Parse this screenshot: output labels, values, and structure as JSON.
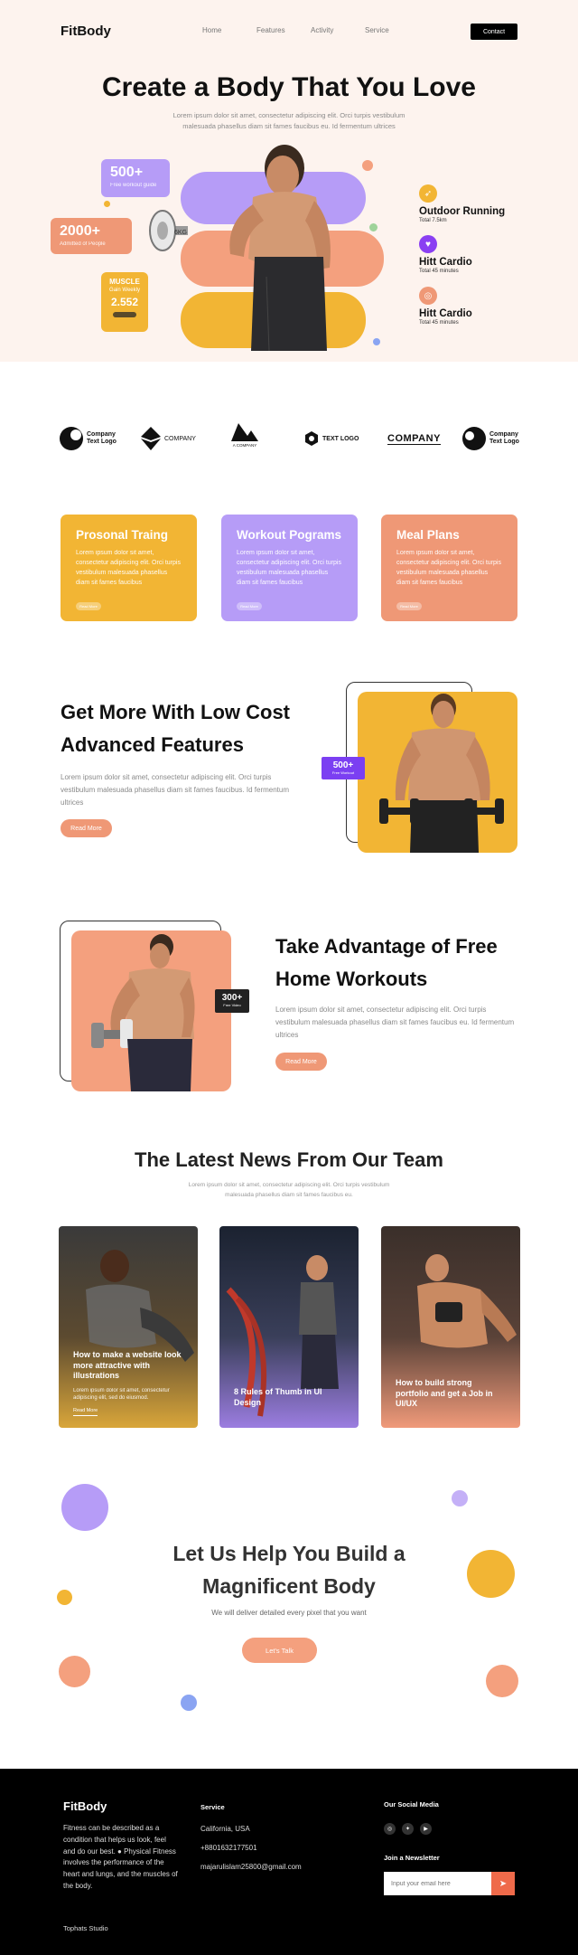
{
  "nav": {
    "logo": "FitBody",
    "links": [
      "Home",
      "Features",
      "Activity",
      "Service"
    ],
    "contact": "Contact"
  },
  "hero": {
    "title": "Create a Body That You Love",
    "subtitle": "Lorem ipsum dolor sit amet, consectetur adipiscing elit. Orci turpis vestibulum malesuada phasellus diam sit fames faucibus eu. Id fermentum ultrices",
    "stat1": {
      "num": "500+",
      "label": "Free workout guide"
    },
    "stat2": {
      "num": "2000+",
      "label": "Admitted of People"
    },
    "muscle": {
      "title": "MUSCLE",
      "sub": "Gain Weekly",
      "num": "2.552"
    },
    "activities": [
      {
        "title": "Outdoor Running",
        "sub": "Total 7.5km",
        "icon": "running-icon",
        "color": "#f2b534",
        "glyph": "🏃"
      },
      {
        "title": "Hitt Cardio",
        "sub": "Total 45 minutes",
        "icon": "heart-icon",
        "color": "#8a3ff2",
        "glyph": "♥"
      },
      {
        "title": "Hitt Cardio",
        "sub": "Total 45 minutes",
        "icon": "cardio-icon",
        "color": "#ef9876",
        "glyph": "◎"
      }
    ]
  },
  "logos": [
    {
      "text": "Company\nText Logo"
    },
    {
      "text": "COMPANY"
    },
    {
      "text": "A COMPANY"
    },
    {
      "text": "TEXT LOGO"
    },
    {
      "text": "COMPANY"
    },
    {
      "text": "Company\nText Logo"
    }
  ],
  "services": [
    {
      "title": "Prosonal Traing",
      "text": "Lorem ipsum dolor sit amet, consectetur adipiscing elit. Orci turpis vestibulum malesuada phasellus diam sit fames faucibus",
      "btn": "Read More"
    },
    {
      "title": "Workout Pograms",
      "text": "Lorem ipsum dolor sit amet, consectetur adipiscing elit. Orci turpis vestibulum malesuada phasellus diam sit fames faucibus",
      "btn": "Read More"
    },
    {
      "title": "Meal Plans",
      "text": "Lorem ipsum dolor sit amet, consectetur adipiscing elit. Orci turpis vestibulum malesuada phasellus diam sit fames faucibus",
      "btn": "Read More"
    }
  ],
  "feature1": {
    "title_line1": "Get More With Low Cost",
    "title_line2": "Advanced Features",
    "text": "Lorem ipsum dolor sit amet, consectetur adipiscing elit. Orci turpis vestibulum malesuada phasellus diam sit fames faucibus. Id fermentum ultrices",
    "button": "Read More",
    "badge_num": "500+",
    "badge_label": "Free Workout"
  },
  "feature2": {
    "title_line1": "Take Advantage of Free",
    "title_line2": "Home Workouts",
    "text": "Lorem ipsum dolor sit amet, consectetur adipiscing elit. Orci turpis vestibulum malesuada phasellus diam sit fames faucibus eu. Id fermentum ultrices",
    "button": "Read More",
    "badge_num": "300+",
    "badge_label": "Free Video"
  },
  "news": {
    "title": "The Latest News From Our Team",
    "subtitle": "Lorem ipsum dolor sit amet, consectetur adipiscing elit. Orci turpis vestibulum malesuada phasellus diam sit fames faucibus eu.",
    "cards": [
      {
        "title": "How to make a website look more attractive with illustrations",
        "text": "Lorem ipsum dolor sit amet, consectetur adipiscing elit, sed do eiusmod.",
        "link": "Read More"
      },
      {
        "title": "8 Rules of Thumb in UI Design"
      },
      {
        "title": "How to build strong portfolio and get a Job in UI/UX"
      }
    ]
  },
  "cta": {
    "title_line1": "Let Us Help You Build a",
    "title_line2": "Magnificent Body",
    "subtitle": "We will deliver detailed every pixel that you want",
    "button": "Let's Talk"
  },
  "footer": {
    "logo": "FitBody",
    "description": "Fitness can be described as a condition that helps us look, feel and do our best. ● Physical Fitness involves the performance of the heart and lungs, and the muscles of the body.",
    "service_heading": "Service",
    "service_items": [
      "California, USA",
      "+8801632177501",
      "majarulislam25800@gmail.com"
    ],
    "social_heading": "Our Social Media",
    "newsletter_heading": "Join a Newsletter",
    "newsletter_placeholder": "Input your email here",
    "studio": "Tophats Studio"
  }
}
